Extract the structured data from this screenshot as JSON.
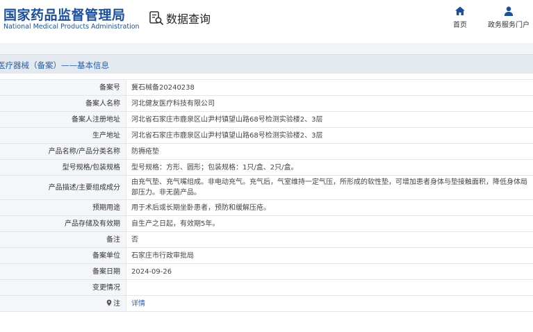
{
  "header": {
    "logo_cn": "国家药品监督管理局",
    "logo_en": "National Medical Products Administration",
    "query_label": "数据查询",
    "nav": [
      {
        "label": "首页",
        "icon": "home-icon"
      },
      {
        "label": "政务服务门户",
        "icon": "user-icon"
      }
    ]
  },
  "section": {
    "title": "医疗器械（备案）——基本信息"
  },
  "colors": {
    "brand": "#1a4f9f",
    "link": "#2a62b8",
    "label_bg": "#f4f6f9",
    "section_bg": "#e4e9f0"
  },
  "rows": [
    {
      "label": "备案号",
      "value": "冀石械备20240238"
    },
    {
      "label": "备案人名称",
      "value": "河北健友医疗科技有限公司"
    },
    {
      "label": "备案人注册地址",
      "value": "河北省石家庄市鹿泉区山尹村镇望山路68号检测实验楼2、3层"
    },
    {
      "label": "生产地址",
      "value": "河北省石家庄市鹿泉区山尹村镇望山路68号检测实验楼2、3层"
    },
    {
      "label": "产品名称/产品分类名称",
      "value": "防褥疮垫"
    },
    {
      "label": "型号规格/包装规格",
      "value": "型号规格：方形、圆形；包装规格：1只/盒、2只/盒。"
    },
    {
      "label": "产品描述/主要组成成分",
      "value": "由充气垫、充气嘴组成。非电动充气。充气后，气室维持一定气压，所形成的软性垫，可增加患者身体与垫接触面积，降低身体局部压力。非无菌产品。"
    },
    {
      "label": "预期用途",
      "value": "用于术后或长期坐卧患者，预防和缓解压疮。"
    },
    {
      "label": "产品存储及有效期",
      "value": "自生产之日起，有效期5年。"
    },
    {
      "label": "备注",
      "value": "否"
    },
    {
      "label": "备案单位",
      "value": "石家庄市行政审批局"
    },
    {
      "label": "备案日期",
      "value": "2024-09-26"
    },
    {
      "label": "变更情况",
      "value": ""
    },
    {
      "label": "注",
      "value": "详情"
    }
  ]
}
